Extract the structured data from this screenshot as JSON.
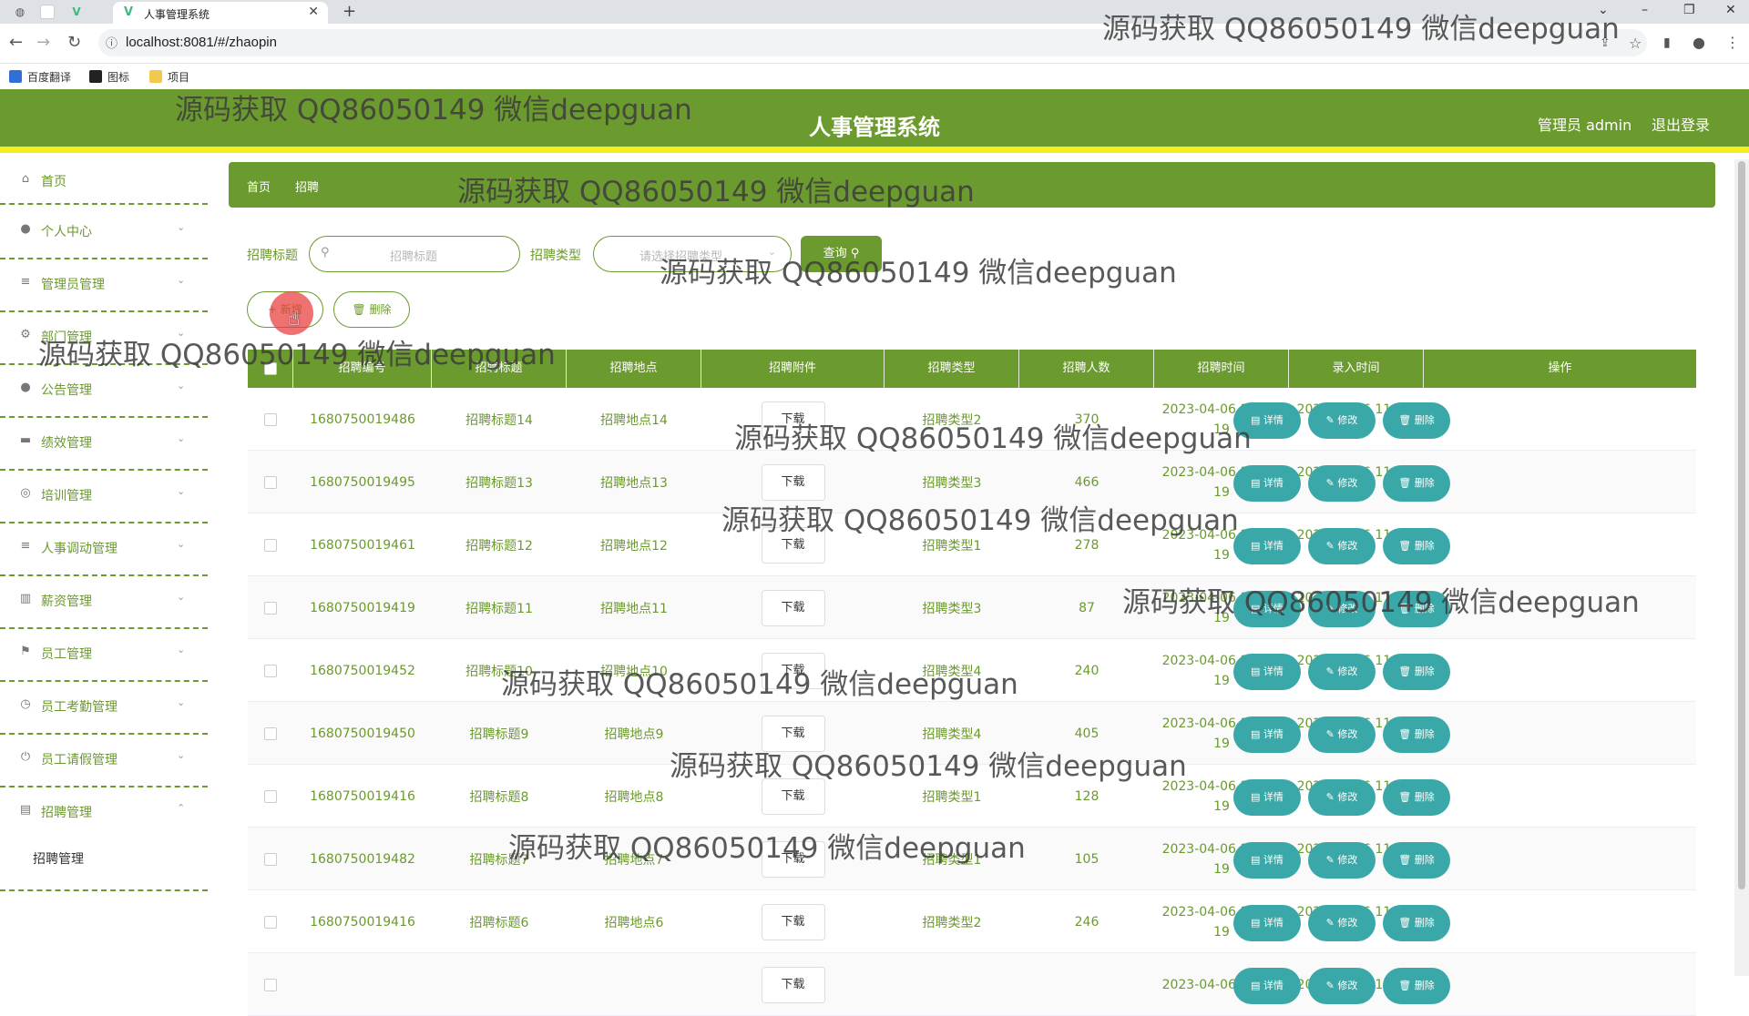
{
  "browser": {
    "tab_title": "人事管理系统",
    "url": "localhost:8081/#/zhaopin",
    "bookmarks": [
      "百度翻译",
      "图标",
      "项目"
    ]
  },
  "header": {
    "title": "人事管理系统",
    "user": "管理员 admin",
    "logout": "退出登录"
  },
  "sidebar": {
    "items": [
      {
        "label": "首页",
        "icon": "home-icon"
      },
      {
        "label": "个人中心",
        "icon": "user-icon"
      },
      {
        "label": "管理员管理",
        "icon": "menu-icon"
      },
      {
        "label": "部门管理",
        "icon": "settings-icon"
      },
      {
        "label": "公告管理",
        "icon": "location-icon"
      },
      {
        "label": "绩效管理",
        "icon": "message-icon"
      },
      {
        "label": "培训管理",
        "icon": "compass-icon"
      },
      {
        "label": "人事调动管理",
        "icon": "menu-icon"
      },
      {
        "label": "薪资管理",
        "icon": "chart-icon"
      },
      {
        "label": "员工管理",
        "icon": "flag-icon"
      },
      {
        "label": "员工考勤管理",
        "icon": "clock-icon"
      },
      {
        "label": "员工请假管理",
        "icon": "power-icon"
      },
      {
        "label": "招聘管理",
        "icon": "tickets-icon"
      }
    ],
    "submenu": "招聘管理"
  },
  "breadcrumb": {
    "home": "首页",
    "sep": "/",
    "current": "招聘"
  },
  "search": {
    "title_label": "招聘标题",
    "title_placeholder": "招聘标题",
    "type_label": "招聘类型",
    "type_placeholder": "请选择招聘类型",
    "query_button": "查询 ⚲"
  },
  "actions": {
    "add": "新增",
    "delete": "删除"
  },
  "table": {
    "headers": [
      "招聘编号",
      "招聘标题",
      "招聘地点",
      "招聘附件",
      "招聘类型",
      "招聘人数",
      "招聘时间",
      "录入时间",
      "操作"
    ],
    "download_label": "下载",
    "op_labels": {
      "detail": "详情",
      "edit": "修改",
      "delete": "删除"
    },
    "rows": [
      {
        "id": "1680750019486",
        "title": "招聘标题14",
        "place": "招聘地点14",
        "type": "招聘类型2",
        "count": "370",
        "time1": "2023-04-06 11:00:",
        "time2": "19",
        "rtime1": "2023-04-06 11:00:",
        "rtime2": "19"
      },
      {
        "id": "1680750019495",
        "title": "招聘标题13",
        "place": "招聘地点13",
        "type": "招聘类型3",
        "count": "466",
        "time1": "2023-04-06 11:00:",
        "time2": "19",
        "rtime1": "2023-04-06 11:00:",
        "rtime2": "19"
      },
      {
        "id": "1680750019461",
        "title": "招聘标题12",
        "place": "招聘地点12",
        "type": "招聘类型1",
        "count": "278",
        "time1": "2023-04-06 11:00:",
        "time2": "19",
        "rtime1": "2023-04-06 11:00:",
        "rtime2": "19"
      },
      {
        "id": "1680750019419",
        "title": "招聘标题11",
        "place": "招聘地点11",
        "type": "招聘类型3",
        "count": "87",
        "time1": "2023-04-06 11:00:",
        "time2": "19",
        "rtime1": "2023-04-06 11:00:",
        "rtime2": "19"
      },
      {
        "id": "1680750019452",
        "title": "招聘标题10",
        "place": "招聘地点10",
        "type": "招聘类型4",
        "count": "240",
        "time1": "2023-04-06 11:00:",
        "time2": "19",
        "rtime1": "2023-04-06 11:00:",
        "rtime2": "19"
      },
      {
        "id": "1680750019450",
        "title": "招聘标题9",
        "place": "招聘地点9",
        "type": "招聘类型4",
        "count": "405",
        "time1": "2023-04-06 11:00:",
        "time2": "19",
        "rtime1": "2023-04-06 11:00:",
        "rtime2": "19"
      },
      {
        "id": "1680750019416",
        "title": "招聘标题8",
        "place": "招聘地点8",
        "type": "招聘类型1",
        "count": "128",
        "time1": "2023-04-06 11:00:",
        "time2": "19",
        "rtime1": "2023-04-06 11:00:",
        "rtime2": "19"
      },
      {
        "id": "1680750019482",
        "title": "招聘标题7",
        "place": "招聘地点7",
        "type": "招聘类型1",
        "count": "105",
        "time1": "2023-04-06 11:00:",
        "time2": "19",
        "rtime1": "2023-04-06 11:00:",
        "rtime2": "19"
      },
      {
        "id": "1680750019416",
        "title": "招聘标题6",
        "place": "招聘地点6",
        "type": "招聘类型2",
        "count": "246",
        "time1": "2023-04-06 11:00:",
        "time2": "19",
        "rtime1": "2023-04-06 11:00:",
        "rtime2": "19"
      },
      {
        "id": "",
        "title": "",
        "place": "",
        "type": "",
        "count": "",
        "time1": "2023-04-06 11:00:",
        "time2": "",
        "rtime1": "2023-04-06 11:00:",
        "rtime2": ""
      }
    ]
  },
  "watermark": "源码获取 QQ86050149 微信deepguan",
  "colors": {
    "primary": "#6b9a2e",
    "accent_line": "#f3f020",
    "op_button": "#3aa8a8"
  }
}
